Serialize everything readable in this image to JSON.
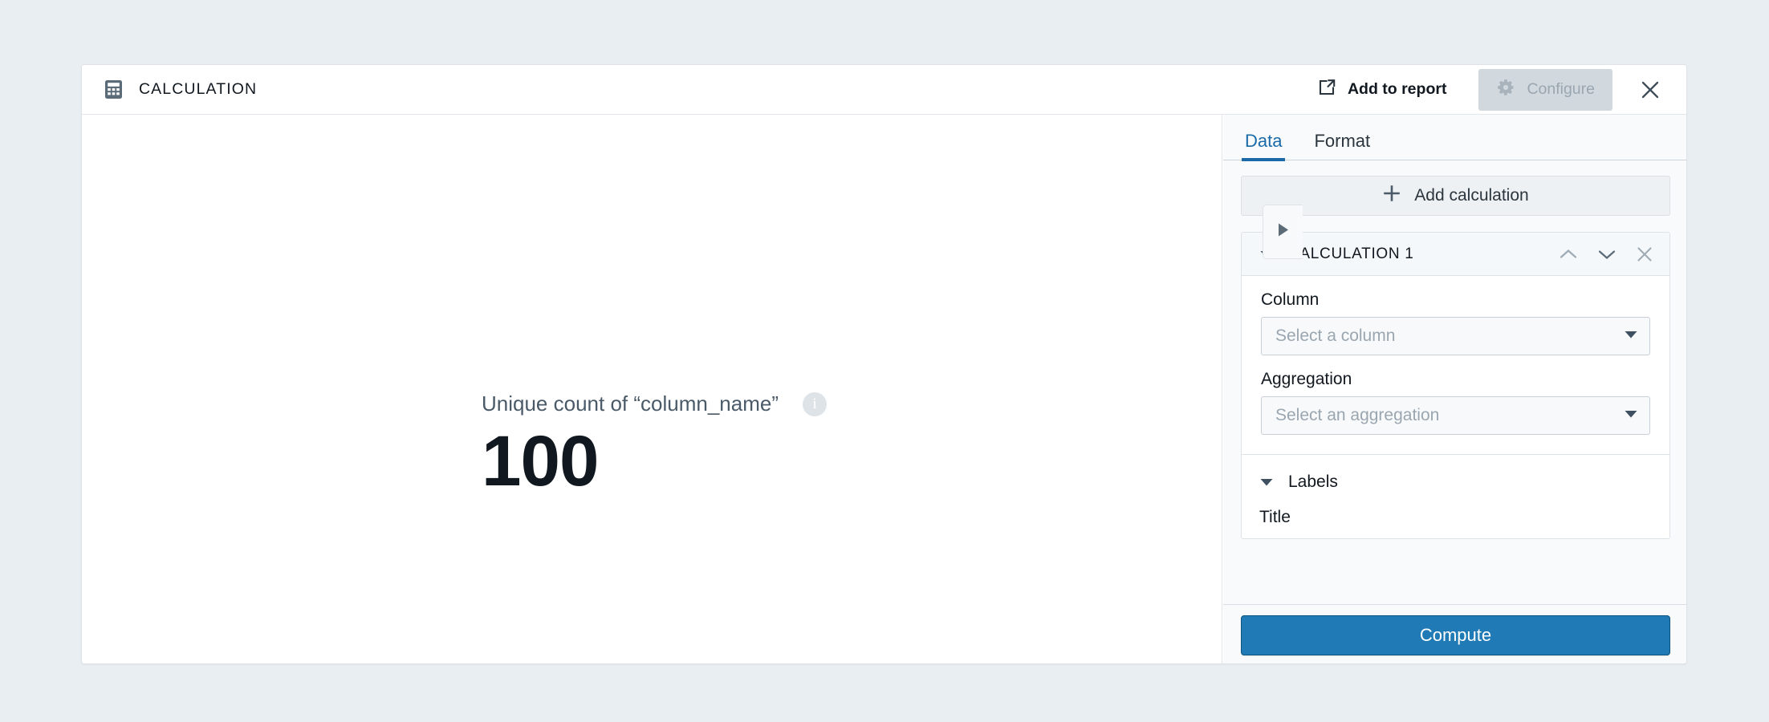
{
  "window": {
    "background_color": "#e9eef2",
    "card_background": "#ffffff"
  },
  "header": {
    "icon": "calculator-icon",
    "title": "CALCULATION",
    "add_to_report_label": "Add to report",
    "add_to_report_icon": "external-link-icon",
    "configure_label": "Configure",
    "configure_icon": "gear-icon",
    "configure_state": "active",
    "close_icon": "close-icon"
  },
  "canvas": {
    "value_label": "Unique count of “column_name”",
    "info_icon": "info-icon",
    "info_glyph": "i",
    "value": "100"
  },
  "panel_toggle": {
    "icon": "triangle-right-icon"
  },
  "panel": {
    "tabs": [
      {
        "label": "Data",
        "active": true
      },
      {
        "label": "Format",
        "active": false
      }
    ],
    "active_tab_color": "#1a6aa8",
    "add_calculation_label": "Add calculation",
    "add_calculation_icon": "plus-icon",
    "calculation": {
      "title": "CALCULATION 1",
      "collapse_icon": "triangle-down-icon",
      "move_up_icon": "chevron-up-icon",
      "move_down_icon": "chevron-down-icon",
      "remove_icon": "close-icon",
      "fields": [
        {
          "label": "Column",
          "placeholder": "Select a column",
          "value": "",
          "dropdown_icon": "triangle-down-icon"
        },
        {
          "label": "Aggregation",
          "placeholder": "Select an aggregation",
          "value": "",
          "dropdown_icon": "triangle-down-icon"
        }
      ]
    },
    "labels_section": {
      "title": "Labels",
      "collapse_icon": "triangle-down-icon",
      "first_field_label": "Title"
    },
    "footer": {
      "compute_label": "Compute",
      "compute_color": "#1f7ab5"
    }
  }
}
